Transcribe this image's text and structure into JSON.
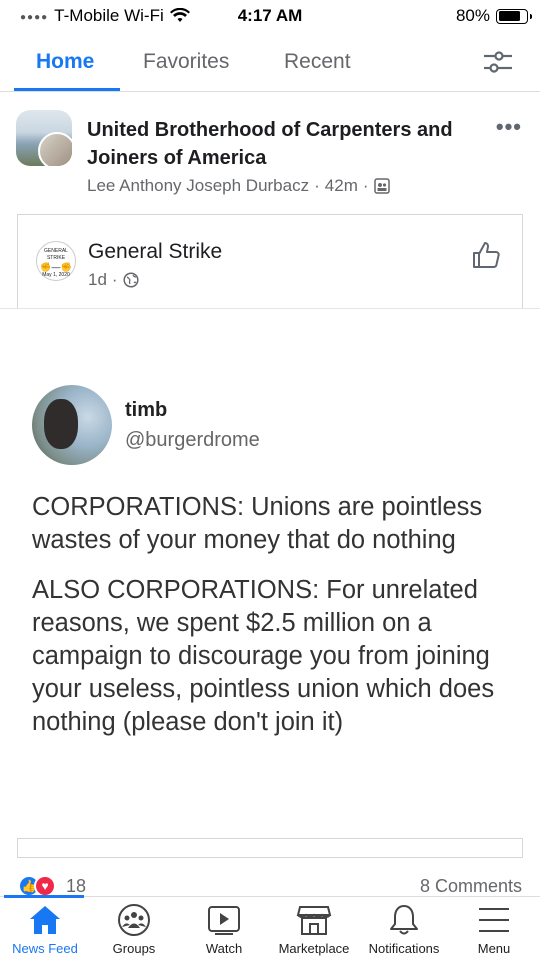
{
  "status_bar": {
    "carrier": "T-Mobile Wi-Fi",
    "time": "4:17 AM",
    "battery": "80%",
    "battery_level": 0.8
  },
  "tabs": [
    {
      "label": "Home",
      "active": true
    },
    {
      "label": "Favorites",
      "active": false
    },
    {
      "label": "Recent",
      "active": false
    }
  ],
  "post": {
    "title": "United Brotherhood of Carpenters and Joiners of America",
    "author": "Lee Anthony Joseph Durbacz",
    "time": "42m",
    "separator": "·"
  },
  "shared": {
    "name": "General Strike",
    "time": "1d",
    "avatar_text": [
      "GENERAL STRIKE",
      "May 1, 2020"
    ]
  },
  "tweet": {
    "name": "timb",
    "handle": "@burgerdrome",
    "paragraph1": "CORPORATIONS: Unions are pointless wastes of your money that do nothing",
    "paragraph2": "ALSO CORPORATIONS: For unrelated reasons, we spent $2.5 million on a campaign to discourage you from joining your useless, pointless union which does nothing (please don't join it)"
  },
  "reactions": {
    "count": "18",
    "comments": "8 Comments"
  },
  "bottom_nav": [
    {
      "label": "News Feed",
      "icon": "home-icon",
      "active": true
    },
    {
      "label": "Groups",
      "icon": "groups-icon",
      "active": false
    },
    {
      "label": "Watch",
      "icon": "watch-icon",
      "active": false
    },
    {
      "label": "Marketplace",
      "icon": "marketplace-icon",
      "active": false
    },
    {
      "label": "Notifications",
      "icon": "bell-icon",
      "active": false
    },
    {
      "label": "Menu",
      "icon": "menu-icon",
      "active": false
    }
  ],
  "colors": {
    "accent": "#1877f2",
    "secondary_text": "#65676b",
    "love": "#f0284a"
  }
}
